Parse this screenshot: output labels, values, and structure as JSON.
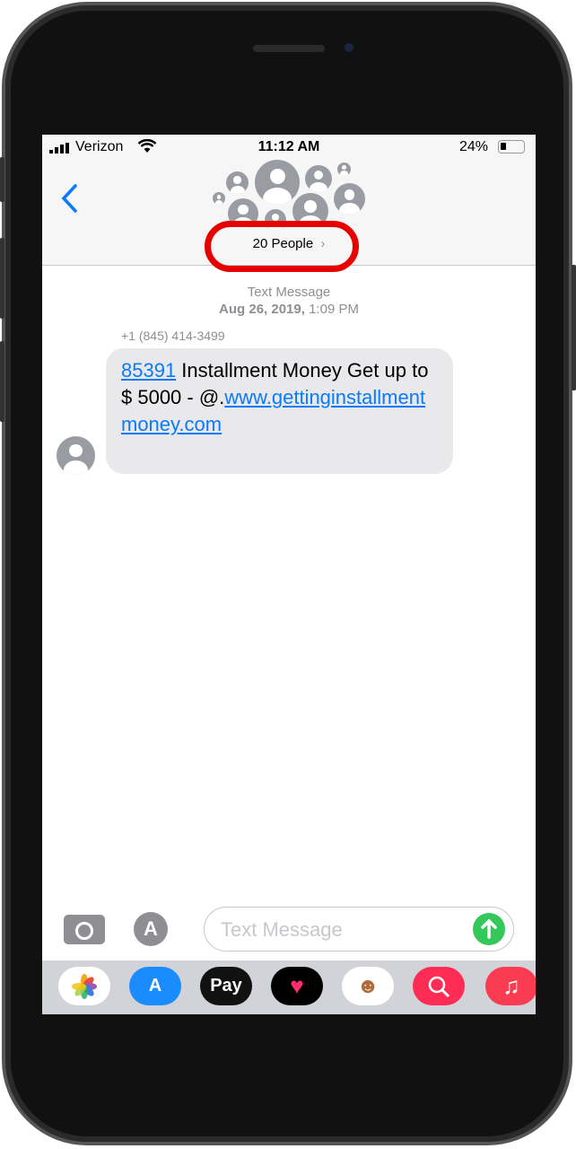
{
  "status": {
    "carrier": "Verizon",
    "time": "11:12 AM",
    "battery": "24%"
  },
  "header": {
    "back_icon": "chevron-left-icon",
    "group_label": "20 People",
    "chevron": "›"
  },
  "thread": {
    "service": "Text Message",
    "date": "Aug 26, 2019,",
    "time": "1:09 PM",
    "sender": "+1 (845) 414-3499",
    "message": {
      "code_link": "85391",
      "text": " Installment Money Get up to $ 5000 - @.",
      "url": "www.gettinginstallmentmoney.com"
    }
  },
  "compose": {
    "placeholder": "Text Message",
    "camera_icon": "camera-icon",
    "apps_icon": "app-store-icon",
    "send_icon": "arrow-up-icon"
  },
  "dock": {
    "apps": [
      {
        "name": "photos-icon"
      },
      {
        "name": "app-store-icon"
      },
      {
        "label": "Pay",
        "name": "apple-pay-icon"
      },
      {
        "name": "digital-touch-icon"
      },
      {
        "name": "memoji-icon"
      },
      {
        "name": "web-images-icon"
      },
      {
        "label": "♫",
        "name": "music-icon"
      }
    ]
  },
  "colors": {
    "accent": "#0a7aff",
    "send": "#34c759",
    "annotation": "#e60000"
  }
}
